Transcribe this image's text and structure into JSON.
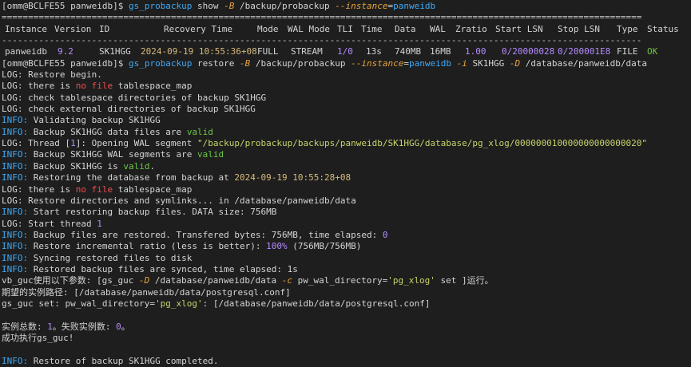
{
  "terminal": {
    "line1": {
      "prompt": "[omm@BCLFE55 panweidb]$ ",
      "cmd": "gs_probackup",
      "sub": " show ",
      "opt_b": "-B",
      "path": " /backup/probackup ",
      "opt_instance": "--instance",
      "eq": "=",
      "instance": "panweidb"
    },
    "rule": "=========================================================================================================================",
    "table": {
      "headers": [
        "Instance",
        "Version",
        "ID",
        "Recovery Time",
        "Mode",
        "WAL Mode",
        "TLI",
        "Time",
        "Data",
        "WAL",
        "Zratio",
        "Start LSN",
        "Stop LSN",
        "Type",
        "Status"
      ],
      "dash": "-------------------------------------------------------------------------------------------------------------------------",
      "row": [
        "panweidb",
        "9.2",
        "SK1HGG",
        "2024-09-19 10:55:36+08",
        "FULL",
        "STREAM",
        "1/0",
        "13s",
        "740MB",
        "16MB",
        "1.00",
        "0/20000028",
        "0/200001E8",
        "FILE",
        "OK"
      ]
    },
    "line_restore": {
      "prompt": "[omm@BCLFE55 panweidb]$ ",
      "cmd": "gs_probackup",
      "sub": " restore ",
      "opt_b": "-B",
      "path": " /backup/probackup ",
      "opt_instance": "--instance",
      "eq": "=",
      "instance": "panweidb",
      "opt_i": " -i",
      "id": " SK1HGG ",
      "opt_d": "-D",
      "dest": " /database/panweidb/data"
    },
    "logs": {
      "l1": "LOG: Restore begin.",
      "l2a": "LOG: there is ",
      "l2b": "no file",
      "l2c": " tablespace_map",
      "l3": "LOG: check tablespace directories of backup SK1HGG",
      "l4": "LOG: check external directories of backup SK1HGG",
      "l5a": "INFO:",
      "l5b": " Validating backup SK1HGG",
      "l6a": "INFO:",
      "l6b": " Backup SK1HGG data files are ",
      "l6c": "valid",
      "l7a": "LOG: Thread [",
      "l7b": "1",
      "l7c": "]: Opening WAL segment ",
      "l7d": "\"/backup/probackup/backups/panweidb/SK1HGG/database/pg_xlog/000000010000000000000020\"",
      "l8a": "INFO:",
      "l8b": " Backup SK1HGG WAL segments are ",
      "l8c": "valid",
      "l9a": "INFO:",
      "l9b": " Backup SK1HGG is ",
      "l9c": "valid",
      "l9d": ".",
      "l10a": "INFO:",
      "l10b": " Restoring the database from backup at ",
      "l10c": "2024-09-19 10:55:28+08",
      "l11a": "LOG: there is ",
      "l11b": "no file",
      "l11c": " tablespace_map",
      "l12": "LOG: Restore directories and symlinks... in /database/panweidb/data",
      "l13a": "INFO:",
      "l13b": " Start restoring backup files. DATA size: 756MB",
      "l14a": "LOG: Start thread ",
      "l14b": "1",
      "l15a": "INFO:",
      "l15b": " Backup files are restored. Transfered bytes: 756MB, time elapsed: ",
      "l15c": "0",
      "l16a": "INFO:",
      "l16b": " Restore incremental ratio (less is better): ",
      "l16c": "100%",
      "l16d": " (756MB/756MB)",
      "l17a": "INFO:",
      "l17b": " Syncing restored files to disk",
      "l18a": "INFO:",
      "l18b": " Restored backup files are synced, time elapsed: 1s",
      "l19a": "vb_guc使用以下参数: [gs_guc ",
      "l19b": "-D",
      "l19c": " /database/panweidb/data ",
      "l19d": "-c",
      "l19e": " pw_wal_directory=",
      "l19f": "'pg_xlog'",
      "l19g": " set ]运行。",
      "l20": "期望的实例路径: [/database/panweidb/data/postgresql.conf]",
      "l21a": "gs_guc set: pw_wal_directory=",
      "l21b": "'pg_xlog'",
      "l21c": ": [/database/panweidb/data/postgresql.conf]",
      "l22a": "实例总数: ",
      "l22b": "1",
      "l22c": "。失败实例数: ",
      "l22d": "0",
      "l22e": "。",
      "l23": "成功执行gs_guc!",
      "l24a": "INFO:",
      "l24b": " Restore of backup SK1HGG completed."
    }
  }
}
